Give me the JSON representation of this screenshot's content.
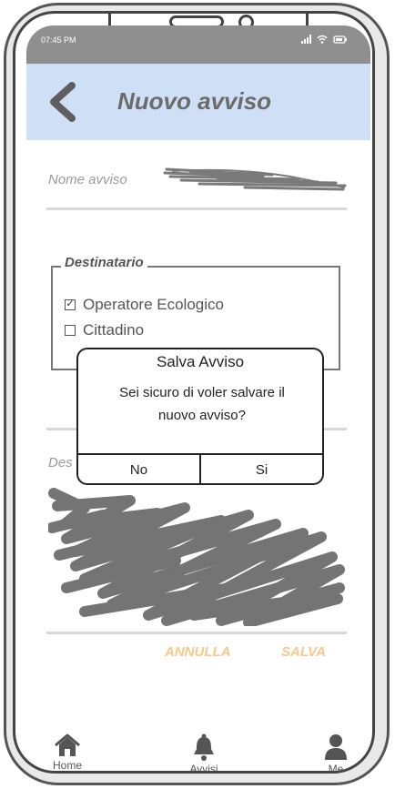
{
  "status_bar": {
    "time": "07:45 PM",
    "icons": "signal-wifi-battery"
  },
  "header": {
    "title": "Nuovo avviso",
    "back_icon": "chevron-left-icon"
  },
  "form": {
    "name_label": "Nome avviso",
    "recipient_legend": "Destinatario",
    "options": [
      {
        "label": "Operatore Ecologico",
        "checked": true
      },
      {
        "label": "Cittadino",
        "checked": false
      }
    ],
    "description_label": "Des",
    "cancel_label": "ANNULLA",
    "save_label": "SALVA"
  },
  "dialog": {
    "title": "Salva Avviso",
    "message_line1": "Sei sicuro di voler salvare il",
    "message_line2": "nuovo avviso?",
    "no_label": "No",
    "yes_label": "Si"
  },
  "nav": {
    "items": [
      {
        "label": "Home",
        "icon": "home-icon"
      },
      {
        "label": "Avvisi",
        "icon": "bell-icon"
      },
      {
        "label": "Me",
        "icon": "user-icon"
      }
    ]
  },
  "colors": {
    "header_bg": "#cfe0f6",
    "accent": "#f6c98a",
    "text": "#555555"
  }
}
